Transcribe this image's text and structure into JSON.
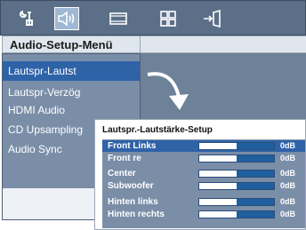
{
  "icon_bar": {
    "tabs": [
      {
        "icon": "general-settings-icon",
        "selected": false
      },
      {
        "icon": "audio-speaker-icon",
        "selected": true
      },
      {
        "icon": "video-screen-icon",
        "selected": false
      },
      {
        "icon": "preferences-grid-icon",
        "selected": false
      },
      {
        "icon": "exit-door-icon",
        "selected": false
      }
    ]
  },
  "menu": {
    "title": "Audio-Setup-Menü",
    "items": [
      {
        "label": "Lautspr-Lautst",
        "selected": true
      },
      {
        "label": "Lautspr-Verzög",
        "selected": false
      },
      {
        "label": "HDMI Audio",
        "selected": false
      },
      {
        "label": "CD Upsampling",
        "selected": false
      },
      {
        "label": "Audio Sync",
        "selected": false
      }
    ]
  },
  "submenu": {
    "title": "Lautspr.-Lautstärke-Setup",
    "rows": [
      {
        "label": "Front Links",
        "value": "0dB",
        "level": 0.5,
        "selected": true
      },
      {
        "label": "Front re",
        "value": "0dB",
        "level": 0.5,
        "selected": false
      },
      {
        "label": "Center",
        "value": "0dB",
        "level": 0.5,
        "selected": false
      },
      {
        "label": "Subwoofer",
        "value": "0dB",
        "level": 0.5,
        "selected": false
      },
      {
        "label": "Hinten links",
        "value": "0dB",
        "level": 0.5,
        "selected": false
      },
      {
        "label": "Hinten rechts",
        "value": "0dB",
        "level": 0.5,
        "selected": false
      }
    ]
  },
  "colors": {
    "selected": "#2f63a8",
    "panel": "#7a8ea8",
    "bar_fill": "#1f5fa0"
  }
}
